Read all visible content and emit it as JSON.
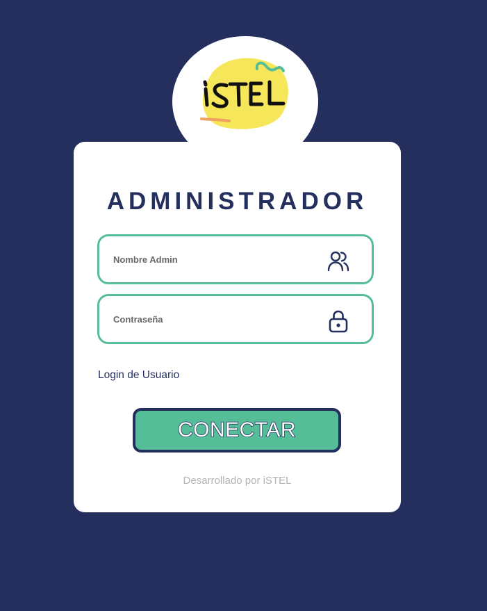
{
  "brand": {
    "logo_text": "iSTEL",
    "colors": {
      "background": "#242f5e",
      "accent": "#56bd99",
      "logo_blob": "#f6e65a",
      "logo_underline": "#f0a060"
    }
  },
  "login": {
    "title": "ADMINISTRADOR",
    "username": {
      "placeholder": "Nombre Admin",
      "value": "",
      "icon": "users-icon"
    },
    "password": {
      "placeholder": "Contraseña",
      "value": "",
      "icon": "lock-icon"
    },
    "user_login_link": "Login de Usuario",
    "submit_label": "CONECTAR",
    "footer_credit": "Desarrollado por iSTEL"
  }
}
